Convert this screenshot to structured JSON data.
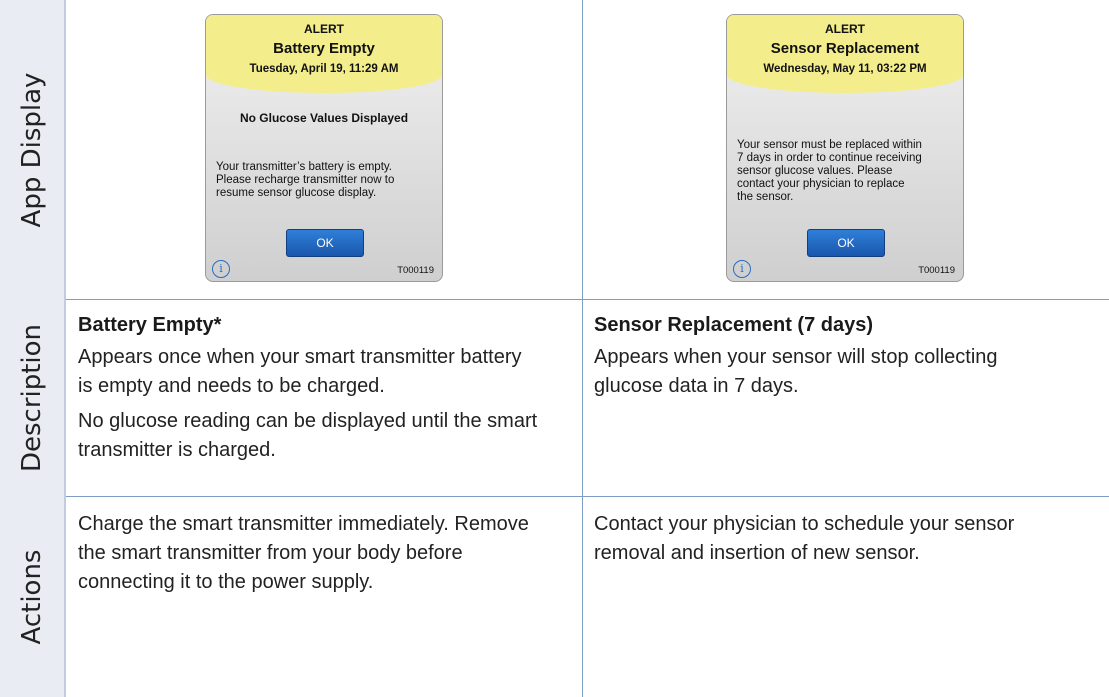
{
  "rows": {
    "app_display": "App Display",
    "description": "Description",
    "actions": "Actions"
  },
  "alerts": [
    {
      "label": "ALERT",
      "title": "Battery Empty",
      "date": "Tuesday, April 19, 11:29 AM",
      "subtitle": "No Glucose Values Displayed",
      "body_lines": [
        "Your transmitter’s battery is empty.",
        "Please recharge transmitter now to",
        "resume sensor glucose display."
      ],
      "ok_label": "OK",
      "info_icon": "i",
      "code": "T000119"
    },
    {
      "label": "ALERT",
      "title": "Sensor Replacement",
      "date": "Wednesday, May 11, 03:22 PM",
      "body_lines": [
        "Your sensor must be replaced within",
        "7 days in order to continue receiving",
        "sensor glucose values. Please",
        "contact your physician to replace",
        "the sensor."
      ],
      "ok_label": "OK",
      "info_icon": "i",
      "code": "T000119"
    }
  ],
  "descriptions": [
    {
      "title": "Battery Empty*",
      "para1_lines": [
        "Appears once when your smart transmitter battery",
        "is empty and needs to be charged."
      ],
      "para2_lines": [
        "No glucose reading can be displayed until the smart",
        "transmitter is charged."
      ]
    },
    {
      "title": "Sensor Replacement (7 days)",
      "para1_lines": [
        "Appears when your sensor will stop collecting",
        "glucose data in 7 days."
      ]
    }
  ],
  "actions": [
    {
      "lines": [
        "Charge the smart transmitter immediately. Remove",
        "the smart transmitter from your body before",
        "connecting it to the power supply."
      ]
    },
    {
      "lines": [
        "Contact your physician to schedule your sensor",
        "removal and insertion of new sensor."
      ]
    }
  ]
}
